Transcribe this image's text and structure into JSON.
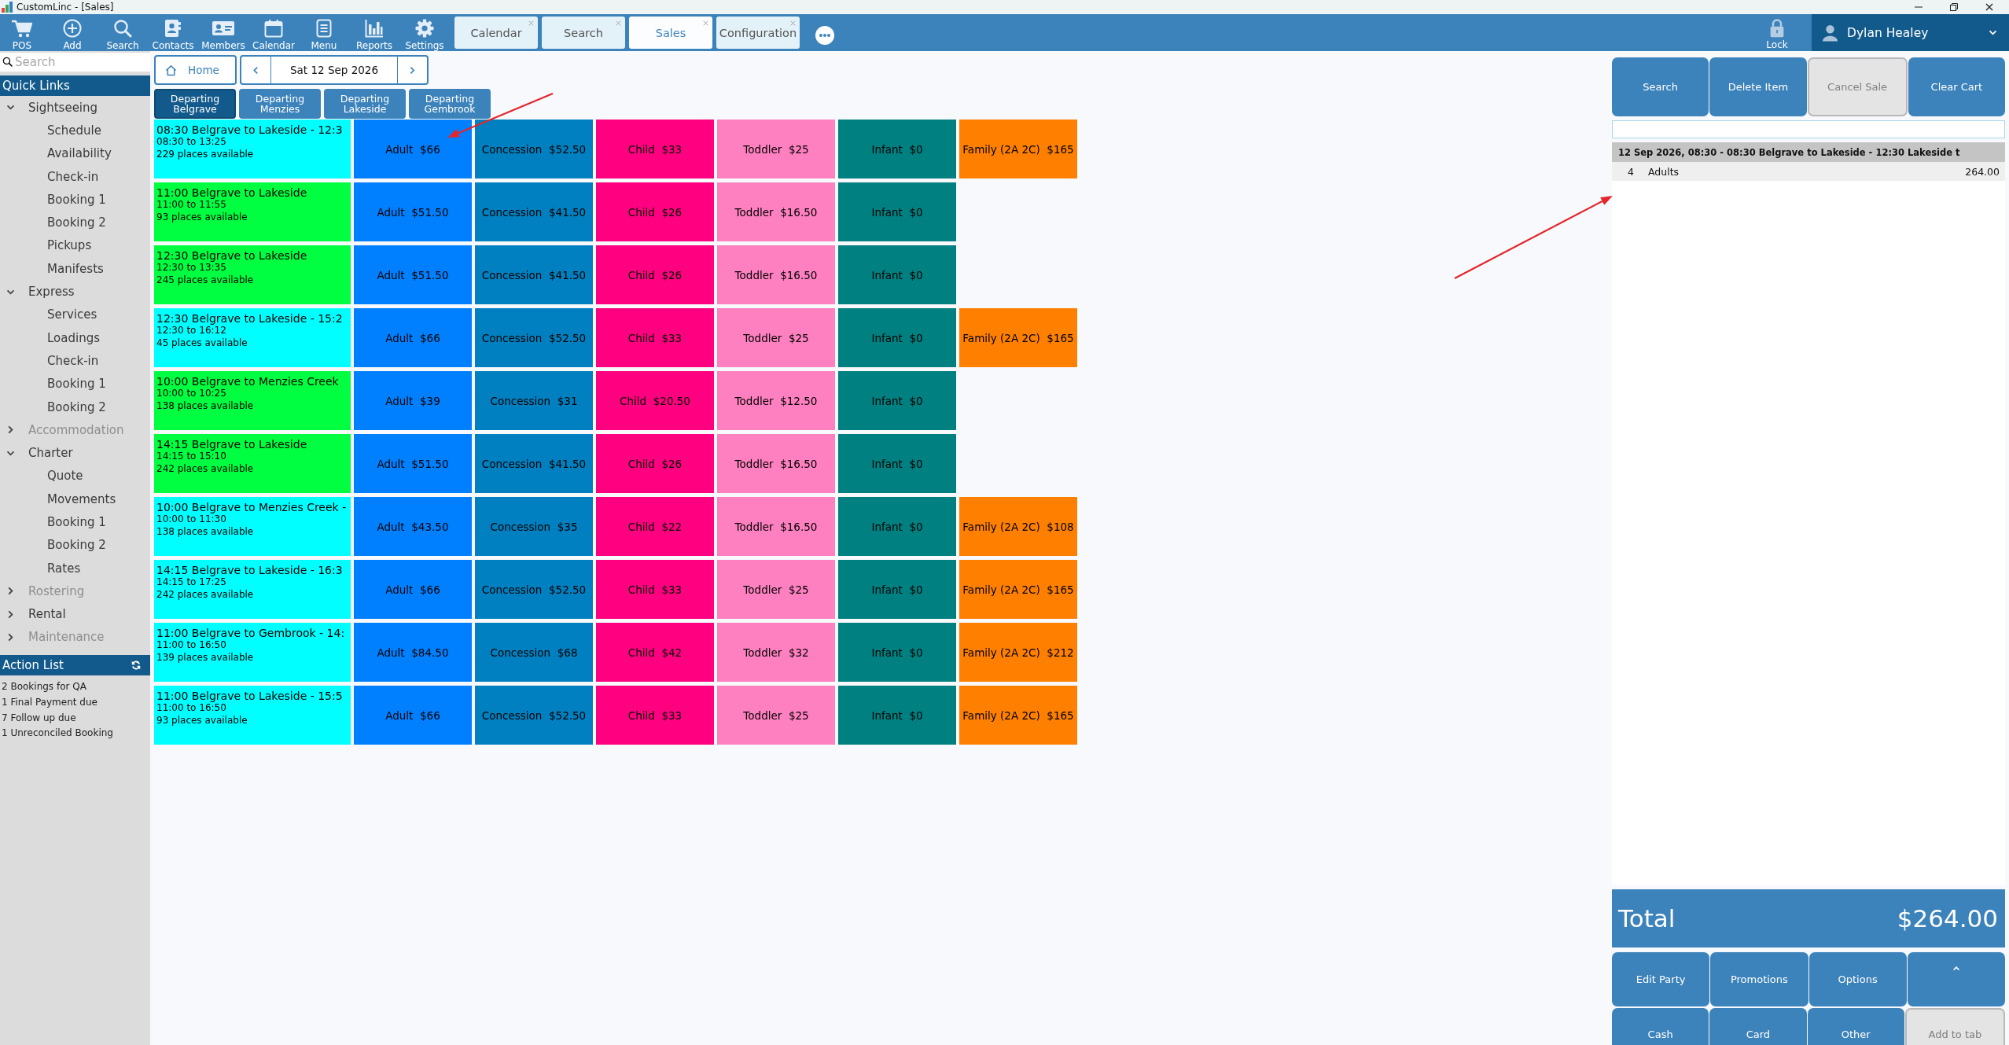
{
  "window": {
    "title": "CustomLinc - [Sales]"
  },
  "toolbar": [
    {
      "label": "POS"
    },
    {
      "label": "Add"
    },
    {
      "label": "Search"
    },
    {
      "label": "Contacts"
    },
    {
      "label": "Members"
    },
    {
      "label": "Calendar"
    },
    {
      "label": "Menu"
    },
    {
      "label": "Reports"
    },
    {
      "label": "Settings"
    }
  ],
  "tabs": [
    {
      "label": "Calendar",
      "selected": false
    },
    {
      "label": "Search",
      "selected": false
    },
    {
      "label": "Sales",
      "selected": true
    },
    {
      "label": "Configuration",
      "selected": false
    }
  ],
  "lock": {
    "label": "Lock"
  },
  "user": {
    "name": "Dylan Healey"
  },
  "sidebar": {
    "search": {
      "placeholder": "Search"
    },
    "quick_links": {
      "title": "Quick Links",
      "items": [
        {
          "label": "Sightseeing",
          "expanded": true,
          "disabled": false,
          "children": [
            {
              "label": "Schedule"
            },
            {
              "label": "Availability"
            },
            {
              "label": "Check-in"
            },
            {
              "label": "Booking 1"
            },
            {
              "label": "Booking 2"
            },
            {
              "label": "Pickups"
            },
            {
              "label": "Manifests"
            }
          ]
        },
        {
          "label": "Express",
          "expanded": true,
          "disabled": false,
          "children": [
            {
              "label": "Services"
            },
            {
              "label": "Loadings"
            },
            {
              "label": "Check-in"
            },
            {
              "label": "Booking 1"
            },
            {
              "label": "Booking 2"
            }
          ]
        },
        {
          "label": "Accommodation",
          "expanded": false,
          "disabled": true
        },
        {
          "label": "Charter",
          "expanded": true,
          "disabled": false,
          "children": [
            {
              "label": "Quote"
            },
            {
              "label": "Movements"
            },
            {
              "label": "Booking 1"
            },
            {
              "label": "Booking 2"
            },
            {
              "label": "Rates"
            }
          ]
        },
        {
          "label": "Rostering",
          "expanded": false,
          "disabled": true
        },
        {
          "label": "Rental",
          "expanded": false,
          "disabled": false
        },
        {
          "label": "Maintenance",
          "expanded": false,
          "disabled": true
        }
      ]
    },
    "action_list": {
      "title": "Action List",
      "items": [
        "2 Bookings for QA",
        "1 Final Payment due",
        "7 Follow up due",
        "1 Unreconciled Booking"
      ]
    }
  },
  "navigation": {
    "home": "Home",
    "date": "Sat 12 Sep 2026"
  },
  "departure_tabs": [
    {
      "label": "Departing Belgrave",
      "selected": true
    },
    {
      "label": "Departing Menzies",
      "selected": false
    },
    {
      "label": "Departing Lakeside",
      "selected": false
    },
    {
      "label": "Departing Gembrook",
      "selected": false
    }
  ],
  "services": [
    {
      "title": "08:30 Belgrave to Lakeside - 12:3",
      "times": "08:30 to 13:25",
      "availability": "229 places available",
      "color": "#00ffff",
      "fares": [
        {
          "label": "Adult",
          "price": "$66",
          "color": "#0080ff"
        },
        {
          "label": "Concession",
          "price": "$52.50",
          "color": "#0080c0"
        },
        {
          "label": "Child",
          "price": "$33",
          "color": "#ff0080"
        },
        {
          "label": "Toddler",
          "price": "$25",
          "color": "#ff80c0"
        },
        {
          "label": "Infant",
          "price": "$0",
          "color": "#008080"
        },
        {
          "label": "Family (2A 2C)",
          "price": "$165",
          "color": "#ff8000"
        }
      ]
    },
    {
      "title": "11:00 Belgrave to Lakeside",
      "times": "11:00 to 11:55",
      "availability": "93 places available",
      "color": "#00ff40",
      "fares": [
        {
          "label": "Adult",
          "price": "$51.50",
          "color": "#0080ff"
        },
        {
          "label": "Concession",
          "price": "$41.50",
          "color": "#0080c0"
        },
        {
          "label": "Child",
          "price": "$26",
          "color": "#ff0080"
        },
        {
          "label": "Toddler",
          "price": "$16.50",
          "color": "#ff80c0"
        },
        {
          "label": "Infant",
          "price": "$0",
          "color": "#008080"
        }
      ]
    },
    {
      "title": "12:30 Belgrave to Lakeside",
      "times": "12:30 to 13:35",
      "availability": "245 places available",
      "color": "#00ff40",
      "fares": [
        {
          "label": "Adult",
          "price": "$51.50",
          "color": "#0080ff"
        },
        {
          "label": "Concession",
          "price": "$41.50",
          "color": "#0080c0"
        },
        {
          "label": "Child",
          "price": "$26",
          "color": "#ff0080"
        },
        {
          "label": "Toddler",
          "price": "$16.50",
          "color": "#ff80c0"
        },
        {
          "label": "Infant",
          "price": "$0",
          "color": "#008080"
        }
      ]
    },
    {
      "title": "12:30 Belgrave to Lakeside - 15:2",
      "times": "12:30 to 16:12",
      "availability": "45 places available",
      "color": "#00ffff",
      "fares": [
        {
          "label": "Adult",
          "price": "$66",
          "color": "#0080ff"
        },
        {
          "label": "Concession",
          "price": "$52.50",
          "color": "#0080c0"
        },
        {
          "label": "Child",
          "price": "$33",
          "color": "#ff0080"
        },
        {
          "label": "Toddler",
          "price": "$25",
          "color": "#ff80c0"
        },
        {
          "label": "Infant",
          "price": "$0",
          "color": "#008080"
        },
        {
          "label": "Family (2A 2C)",
          "price": "$165",
          "color": "#ff8000"
        }
      ]
    },
    {
      "title": "10:00 Belgrave to Menzies Creek",
      "times": "10:00 to 10:25",
      "availability": "138 places available",
      "color": "#00ff40",
      "fares": [
        {
          "label": "Adult",
          "price": "$39",
          "color": "#0080ff"
        },
        {
          "label": "Concession",
          "price": "$31",
          "color": "#0080c0"
        },
        {
          "label": "Child",
          "price": "$20.50",
          "color": "#ff0080"
        },
        {
          "label": "Toddler",
          "price": "$12.50",
          "color": "#ff80c0"
        },
        {
          "label": "Infant",
          "price": "$0",
          "color": "#008080"
        }
      ]
    },
    {
      "title": "14:15 Belgrave to Lakeside",
      "times": "14:15 to 15:10",
      "availability": "242 places available",
      "color": "#00ff40",
      "fares": [
        {
          "label": "Adult",
          "price": "$51.50",
          "color": "#0080ff"
        },
        {
          "label": "Concession",
          "price": "$41.50",
          "color": "#0080c0"
        },
        {
          "label": "Child",
          "price": "$26",
          "color": "#ff0080"
        },
        {
          "label": "Toddler",
          "price": "$16.50",
          "color": "#ff80c0"
        },
        {
          "label": "Infant",
          "price": "$0",
          "color": "#008080"
        }
      ]
    },
    {
      "title": "10:00 Belgrave to Menzies Creek -",
      "times": "10:00 to 11:30",
      "availability": "138 places available",
      "color": "#00ffff",
      "fares": [
        {
          "label": "Adult",
          "price": "$43.50",
          "color": "#0080ff"
        },
        {
          "label": "Concession",
          "price": "$35",
          "color": "#0080c0"
        },
        {
          "label": "Child",
          "price": "$22",
          "color": "#ff0080"
        },
        {
          "label": "Toddler",
          "price": "$16.50",
          "color": "#ff80c0"
        },
        {
          "label": "Infant",
          "price": "$0",
          "color": "#008080"
        },
        {
          "label": "Family (2A 2C)",
          "price": "$108",
          "color": "#ff8000"
        }
      ]
    },
    {
      "title": "14:15 Belgrave to Lakeside - 16:3",
      "times": "14:15 to 17:25",
      "availability": "242 places available",
      "color": "#00ffff",
      "fares": [
        {
          "label": "Adult",
          "price": "$66",
          "color": "#0080ff"
        },
        {
          "label": "Concession",
          "price": "$52.50",
          "color": "#0080c0"
        },
        {
          "label": "Child",
          "price": "$33",
          "color": "#ff0080"
        },
        {
          "label": "Toddler",
          "price": "$25",
          "color": "#ff80c0"
        },
        {
          "label": "Infant",
          "price": "$0",
          "color": "#008080"
        },
        {
          "label": "Family (2A 2C)",
          "price": "$165",
          "color": "#ff8000"
        }
      ]
    },
    {
      "title": "11:00 Belgrave to Gembrook - 14:",
      "times": "11:00 to 16:50",
      "availability": "139 places available",
      "color": "#00ffff",
      "fares": [
        {
          "label": "Adult",
          "price": "$84.50",
          "color": "#0080ff"
        },
        {
          "label": "Concession",
          "price": "$68",
          "color": "#0080c0"
        },
        {
          "label": "Child",
          "price": "$42",
          "color": "#ff0080"
        },
        {
          "label": "Toddler",
          "price": "$32",
          "color": "#ff80c0"
        },
        {
          "label": "Infant",
          "price": "$0",
          "color": "#008080"
        },
        {
          "label": "Family (2A 2C)",
          "price": "$212",
          "color": "#ff8000"
        }
      ]
    },
    {
      "title": "11:00 Belgrave to Lakeside - 15:5",
      "times": "11:00 to 16:50",
      "availability": "93 places available",
      "color": "#00ffff",
      "fares": [
        {
          "label": "Adult",
          "price": "$66",
          "color": "#0080ff"
        },
        {
          "label": "Concession",
          "price": "$52.50",
          "color": "#0080c0"
        },
        {
          "label": "Child",
          "price": "$33",
          "color": "#ff0080"
        },
        {
          "label": "Toddler",
          "price": "$25",
          "color": "#ff80c0"
        },
        {
          "label": "Infant",
          "price": "$0",
          "color": "#008080"
        },
        {
          "label": "Family (2A 2C)",
          "price": "$165",
          "color": "#ff8000"
        }
      ]
    }
  ],
  "cart": {
    "actions": [
      {
        "label": "Search",
        "disabled": false
      },
      {
        "label": "Delete Item",
        "disabled": false
      },
      {
        "label": "Cancel Sale",
        "disabled": true
      },
      {
        "label": "Clear Cart",
        "disabled": false
      }
    ],
    "groups": [
      {
        "heading": "12 Sep 2026, 08:30 - 08:30 Belgrave to Lakeside - 12:30 Lakeside t",
        "lines": [
          {
            "quantity": "4",
            "description": "Adults",
            "amount": "264.00"
          }
        ]
      }
    ],
    "total": {
      "label": "Total",
      "amount": "$264.00"
    },
    "button_rows": [
      [
        {
          "kind": "text",
          "label": "Edit Party",
          "disabled": false
        },
        {
          "kind": "text",
          "label": "Promotions",
          "disabled": false
        },
        {
          "kind": "text",
          "label": "Options",
          "disabled": false
        },
        {
          "kind": "icon",
          "disabled": false
        }
      ],
      [
        {
          "kind": "text",
          "label": "Cash",
          "disabled": false
        },
        {
          "kind": "text",
          "label": "Card",
          "disabled": false
        },
        {
          "kind": "text",
          "label": "Other",
          "disabled": false
        },
        {
          "kind": "text",
          "label": "Add to tab",
          "disabled": true
        }
      ]
    ]
  }
}
